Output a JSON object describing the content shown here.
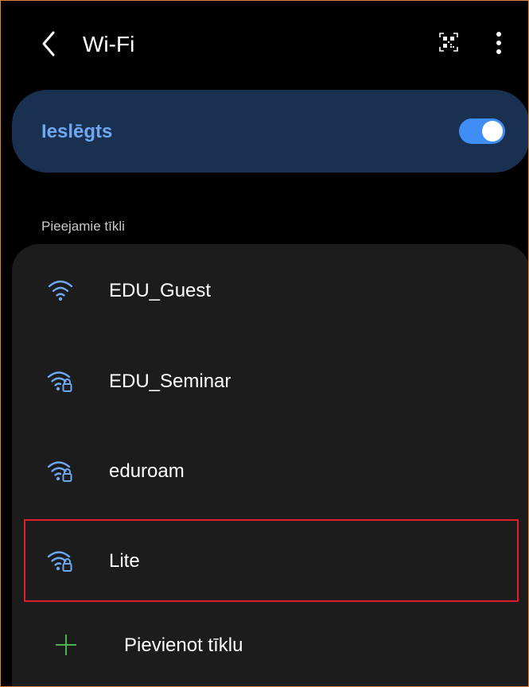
{
  "header": {
    "title": "Wi-Fi",
    "back_icon": "chevron-left-icon",
    "qr_icon": "qr-code-icon",
    "more_icon": "more-vertical-icon"
  },
  "toggle": {
    "label": "Ieslēgts",
    "state": "on",
    "accent_color": "#3e8ef5"
  },
  "networks_section": {
    "label": "Pieejamie tīkli",
    "networks": [
      {
        "name": "EDU_Guest",
        "secured": false,
        "icon": "wifi-icon"
      },
      {
        "name": "EDU_Seminar",
        "secured": true,
        "icon": "wifi-lock-icon"
      },
      {
        "name": "eduroam",
        "secured": true,
        "icon": "wifi-lock-icon"
      },
      {
        "name": "Lite",
        "secured": true,
        "icon": "wifi-lock-icon",
        "highlighted": true
      }
    ],
    "add_network_label": "Pievienot tīklu",
    "add_icon": "plus-icon"
  },
  "colors": {
    "wifi_icon": "#6ea8f2",
    "add_icon": "#4caf50",
    "highlight": "#e01e2a",
    "card_bg": "#1c1c1c",
    "toggle_bg": "#1a3050"
  }
}
